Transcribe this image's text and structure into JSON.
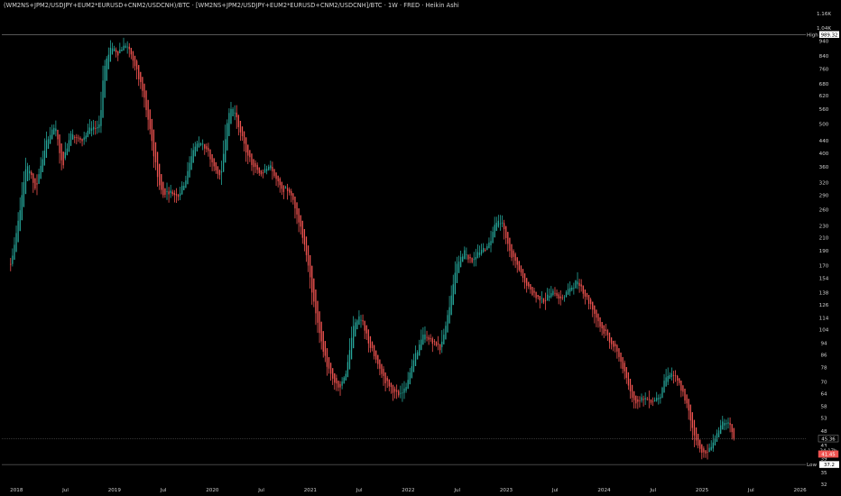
{
  "header": {
    "title": "(WM2NS+JPM2/USDJPY+EUM2*EURUSD+CNM2/USDCNH)/BTC · [WM2NS+JPM2/USDJPY+EUM2*EURUSD+CNM2/USDCNH]/BTC · 1W · FRED · Heikin Ashi"
  },
  "colors": {
    "background": "#000000",
    "up": "#26a69a",
    "down": "#ef5350",
    "axis_text": "#cfcfcf",
    "ref_line": "#8a8a8a"
  },
  "chart_data": {
    "type": "candlestick",
    "style": "Heikin Ashi",
    "interval": "1W",
    "y_scale": "log",
    "ylim": [
      30.5,
      1270
    ],
    "xlim": [
      2017.85,
      2026.05
    ],
    "y_ticks": [
      "1.28K",
      "1.16K",
      "1.04K",
      "940",
      "840",
      "760",
      "680",
      "620",
      "560",
      "500",
      "440",
      "400",
      "360",
      "320",
      "290",
      "260",
      "230",
      "210",
      "190",
      "170",
      "154",
      "138",
      "126",
      "114",
      "104",
      "94",
      "86",
      "78",
      "70",
      "64",
      "58",
      "53",
      "48",
      "43",
      "39",
      "35",
      "32"
    ],
    "x_ticks": [
      {
        "label": "2018",
        "t": 2018.0
      },
      {
        "label": "Jul",
        "t": 2018.5
      },
      {
        "label": "2019",
        "t": 2019.0
      },
      {
        "label": "Jul",
        "t": 2019.5
      },
      {
        "label": "2020",
        "t": 2020.0
      },
      {
        "label": "Jul",
        "t": 2020.5
      },
      {
        "label": "2021",
        "t": 2021.0
      },
      {
        "label": "Jul",
        "t": 2021.5
      },
      {
        "label": "2022",
        "t": 2022.0
      },
      {
        "label": "Jul",
        "t": 2022.5
      },
      {
        "label": "2023",
        "t": 2023.0
      },
      {
        "label": "Jul",
        "t": 2023.5
      },
      {
        "label": "2024",
        "t": 2024.0
      },
      {
        "label": "Jul",
        "t": 2024.5
      },
      {
        "label": "2025",
        "t": 2025.0
      },
      {
        "label": "Jul",
        "t": 2025.5
      },
      {
        "label": "2026",
        "t": 2026.0
      }
    ],
    "anchors": [
      [
        2017.94,
        165
      ],
      [
        2018.0,
        210
      ],
      [
        2018.12,
        380
      ],
      [
        2018.2,
        300
      ],
      [
        2018.32,
        440
      ],
      [
        2018.4,
        500
      ],
      [
        2018.48,
        360
      ],
      [
        2018.56,
        470
      ],
      [
        2018.66,
        440
      ],
      [
        2018.76,
        480
      ],
      [
        2018.86,
        490
      ],
      [
        2018.9,
        760
      ],
      [
        2018.97,
        900
      ],
      [
        2019.05,
        860
      ],
      [
        2019.13,
        920
      ],
      [
        2019.2,
        820
      ],
      [
        2019.3,
        640
      ],
      [
        2019.38,
        460
      ],
      [
        2019.46,
        320
      ],
      [
        2019.5,
        290
      ],
      [
        2019.56,
        300
      ],
      [
        2019.66,
        290
      ],
      [
        2019.74,
        330
      ],
      [
        2019.82,
        420
      ],
      [
        2019.9,
        440
      ],
      [
        2019.96,
        400
      ],
      [
        2020.03,
        360
      ],
      [
        2020.1,
        330
      ],
      [
        2020.16,
        520
      ],
      [
        2020.22,
        580
      ],
      [
        2020.3,
        460
      ],
      [
        2020.4,
        370
      ],
      [
        2020.5,
        340
      ],
      [
        2020.58,
        370
      ],
      [
        2020.66,
        330
      ],
      [
        2020.72,
        300
      ],
      [
        2020.8,
        300
      ],
      [
        2020.88,
        250
      ],
      [
        2020.95,
        200
      ],
      [
        2021.05,
        125
      ],
      [
        2021.12,
        95
      ],
      [
        2021.2,
        75
      ],
      [
        2021.3,
        66
      ],
      [
        2021.38,
        75
      ],
      [
        2021.45,
        110
      ],
      [
        2021.52,
        115
      ],
      [
        2021.58,
        100
      ],
      [
        2021.66,
        85
      ],
      [
        2021.76,
        72
      ],
      [
        2021.85,
        66
      ],
      [
        2021.92,
        62
      ],
      [
        2022.0,
        70
      ],
      [
        2022.08,
        85
      ],
      [
        2022.16,
        100
      ],
      [
        2022.26,
        95
      ],
      [
        2022.34,
        90
      ],
      [
        2022.42,
        118
      ],
      [
        2022.5,
        170
      ],
      [
        2022.58,
        190
      ],
      [
        2022.66,
        175
      ],
      [
        2022.76,
        190
      ],
      [
        2022.84,
        200
      ],
      [
        2022.9,
        240
      ],
      [
        2022.98,
        230
      ],
      [
        2023.04,
        190
      ],
      [
        2023.12,
        170
      ],
      [
        2023.2,
        150
      ],
      [
        2023.3,
        135
      ],
      [
        2023.4,
        130
      ],
      [
        2023.5,
        140
      ],
      [
        2023.56,
        130
      ],
      [
        2023.64,
        140
      ],
      [
        2023.72,
        150
      ],
      [
        2023.8,
        140
      ],
      [
        2023.9,
        120
      ],
      [
        2024.0,
        104
      ],
      [
        2024.08,
        94
      ],
      [
        2024.16,
        86
      ],
      [
        2024.24,
        70
      ],
      [
        2024.32,
        60
      ],
      [
        2024.4,
        62
      ],
      [
        2024.5,
        60
      ],
      [
        2024.58,
        63
      ],
      [
        2024.64,
        72
      ],
      [
        2024.7,
        75
      ],
      [
        2024.78,
        68
      ],
      [
        2024.86,
        58
      ],
      [
        2024.92,
        48
      ],
      [
        2024.98,
        42
      ],
      [
        2025.06,
        40
      ],
      [
        2025.12,
        44
      ],
      [
        2025.2,
        50
      ],
      [
        2025.28,
        52
      ],
      [
        2025.34,
        45
      ]
    ],
    "seed": 7,
    "ref_lines": [
      {
        "label": "High",
        "value": 989.32
      },
      {
        "label": "Low",
        "value": 37.2
      }
    ],
    "tags": [
      {
        "text": "45.36",
        "value": 45.36
      },
      {
        "text": "24:17h",
        "value": 41.45
      },
      {
        "text": "41.45",
        "value": 40.3
      }
    ]
  }
}
